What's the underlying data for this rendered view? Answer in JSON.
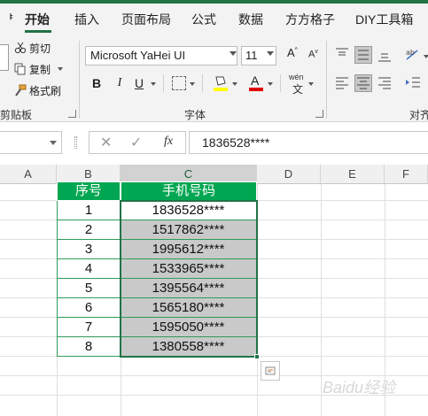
{
  "ribbon_tabs": [
    {
      "label": "开始",
      "active": true
    },
    {
      "label": "插入"
    },
    {
      "label": "页面布局"
    },
    {
      "label": "公式"
    },
    {
      "label": "数据"
    },
    {
      "label": "方方格子"
    },
    {
      "label": "DIY工具箱"
    }
  ],
  "ribbon_tab_cutoff": "ᅣ",
  "clipboard": {
    "cut": "剪切",
    "copy": "复制",
    "format_painter": "格式刷",
    "group_label": "剪贴板"
  },
  "font_group": {
    "font_name": "Microsoft YaHei UI",
    "font_size": "11",
    "bold": "B",
    "italic": "I",
    "underline": "U",
    "group_label": "字体",
    "phonetic": "wén"
  },
  "alignment_group": {
    "group_label": "对齐"
  },
  "formula_bar": {
    "fx": "fx",
    "value": "1836528****"
  },
  "columns": [
    "A",
    "B",
    "C",
    "D",
    "E",
    "F"
  ],
  "table": {
    "headers": [
      "序号",
      "手机号码"
    ],
    "rows": [
      [
        "1",
        "1836528****"
      ],
      [
        "2",
        "1517862****"
      ],
      [
        "3",
        "1995612****"
      ],
      [
        "4",
        "1533965****"
      ],
      [
        "5",
        "1395564****"
      ],
      [
        "6",
        "1565180****"
      ],
      [
        "7",
        "1595050****"
      ],
      [
        "8",
        "1380558****"
      ]
    ]
  },
  "colors": {
    "accent": "#217346",
    "header_fill": "#00a651",
    "selection_fill": "#c9c9c9"
  },
  "watermark": "Baidu经验"
}
